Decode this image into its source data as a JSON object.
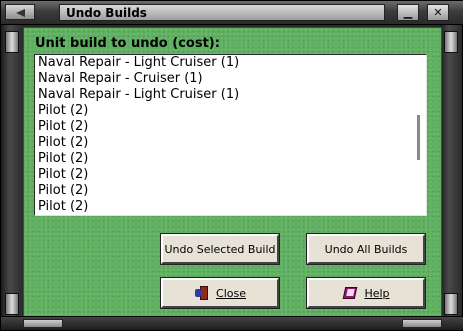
{
  "window": {
    "title": "Undo Builds",
    "minimize_glyph": "▁",
    "close_glyph": "✕"
  },
  "content": {
    "prompt": "Unit build to undo (cost):",
    "items": [
      "Naval Repair - Light Cruiser (1)",
      "Naval Repair - Cruiser (1)",
      "Naval Repair - Light Cruiser (1)",
      "Pilot (2)",
      "Pilot (2)",
      "Pilot (2)",
      "Pilot (2)",
      "Pilot (2)",
      "Pilot (2)",
      "Pilot (2)"
    ]
  },
  "buttons": {
    "undo_selected": "Undo Selected Build",
    "undo_all": "Undo All Builds",
    "close": "Close",
    "help": "Help"
  },
  "icons": {
    "close_button_icon": "exit-door-icon",
    "help_button_icon": "book-icon"
  },
  "colors": {
    "content_background": "#5fb060",
    "button_face": "#e7e2d6",
    "frame": "#2b2b2b"
  }
}
